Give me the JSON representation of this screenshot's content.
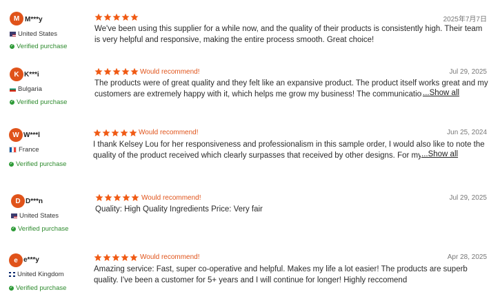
{
  "reviews": [
    {
      "initial": "M",
      "name": "M***y",
      "country": "United States",
      "flag": "us",
      "verified": "Verified purchase",
      "stars": 5,
      "recommend": "",
      "date": "2025年7月7日",
      "text": "We've been using this supplier for a while now, and the quality of their products is consistently high. Their team is very helpful and responsive, making the entire process smooth. Great choice!",
      "show_all": ""
    },
    {
      "initial": "K",
      "name": "K***i",
      "country": "Bulgaria",
      "flag": "bg",
      "verified": "Verified purchase",
      "stars": 5,
      "recommend": "Would recommend!",
      "date": "Jul 29, 2025",
      "text_line1": "The products were of great quality and they felt like an expansive product. The product itself works great and my",
      "text_line2": "customers are extremely happy with it, which helps me grow my business! The communication v",
      "show_all": "...Show all"
    },
    {
      "initial": "W",
      "name": "W***l",
      "country": "France",
      "flag": "fr",
      "verified": "Verified purchase",
      "stars": 5,
      "recommend": "Would recommend!",
      "date": "Jun 25, 2024",
      "text_line1": "I thank Kelsey Lou for her responsiveness and professionalism in this sample order, I would also like to note the",
      "text_line2": "quality of the product received which clearly surpasses that received by other designs. For my p",
      "show_all": "...Show all"
    },
    {
      "initial": "D",
      "name": "D***n",
      "country": "United States",
      "flag": "us",
      "verified": "Verified purchase",
      "stars": 5,
      "recommend": "Would recommend!",
      "date": "Jul 29, 2025",
      "text": "Quality: High Quality Ingredients Price: Very fair",
      "show_all": ""
    },
    {
      "initial": "e",
      "name": "e***y",
      "country": "United Kingdom",
      "flag": "uk",
      "verified": "Verified purchase",
      "stars": 5,
      "recommend": "Would recommend!",
      "date": "Apr 28, 2025",
      "text_line1": "Amazing service: Fast, super co-operative and helpful. Makes my life a lot easier! The products are superb",
      "text_line2": "quality. I've been a customer for 5+ years and I will continue for longer! Highly reccomend",
      "show_all": ""
    }
  ],
  "colors": {
    "accent": "#e0531a",
    "verified": "#2e8b2e",
    "star": "#f05a14"
  }
}
